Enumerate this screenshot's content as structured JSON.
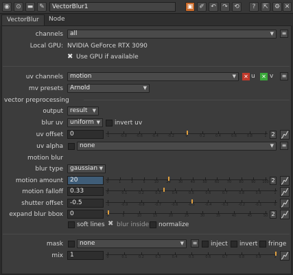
{
  "header": {
    "title": "VectorBlur1"
  },
  "tabs": [
    "VectorBlur",
    "Node"
  ],
  "channels": {
    "label": "channels",
    "value": "all"
  },
  "local_gpu": {
    "label": "Local GPU:",
    "value": "NVIDIA GeForce RTX 3090"
  },
  "use_gpu": {
    "label": "Use GPU if available",
    "checked": true
  },
  "uv_channels": {
    "label": "uv channels",
    "value": "motion",
    "u_label": "u",
    "v_label": "v"
  },
  "mv_presets": {
    "label": "mv presets",
    "value": "Arnold"
  },
  "vector_preprocessing": {
    "label": "vector preprocessing"
  },
  "output": {
    "label": "output",
    "value": "result"
  },
  "blur_uv": {
    "label": "blur uv",
    "value": "uniform",
    "invert_label": "invert uv"
  },
  "uv_offset": {
    "label": "uv offset",
    "value": "0",
    "ticks": [
      "-1",
      "-0.8",
      "-0.6",
      "-0.4",
      "-0.2",
      "0",
      "0.2",
      "0.4",
      "0.6",
      "0.8",
      "1"
    ],
    "num_btn": "2"
  },
  "uv_alpha": {
    "label": "uv alpha",
    "value": "none"
  },
  "motion_blur": {
    "label": "motion blur"
  },
  "blur_type": {
    "label": "blur type",
    "value": "gaussian"
  },
  "motion_amount": {
    "label": "motion amount",
    "value": "20",
    "ticks": [
      "0",
      "1",
      "3",
      "5",
      "10",
      "20",
      "30",
      "40",
      "50",
      "60",
      "70",
      "80",
      "90",
      "100"
    ],
    "num_btn": "2"
  },
  "motion_falloff": {
    "label": "motion falloff",
    "value": "0.33",
    "ticks": [
      "0",
      "0.1",
      "0.2",
      "0.3",
      "0.4",
      "0.5",
      "0.6",
      "0.7",
      "0.8",
      "0.9",
      "1"
    ]
  },
  "shutter_offset": {
    "label": "shutter offset",
    "value": "-0.5",
    "ticks": [
      "-1",
      "-0.9",
      "-0.8",
      "-0.7",
      "-0.6",
      "-0.5",
      "-0.4",
      "-0.3",
      "-0.2",
      "-0.1",
      "0"
    ]
  },
  "expand_blur_bbox": {
    "label": "expand blur bbox",
    "value": "0",
    "ticks": [
      "0",
      "5",
      "10",
      "15",
      "20",
      "25",
      "30",
      "35",
      "40",
      "45",
      "50"
    ],
    "num_btn": "2"
  },
  "options": {
    "soft_lines": "soft lines",
    "blur_inside": "blur inside",
    "normalize": "normalize"
  },
  "mask": {
    "label": "mask",
    "value": "none",
    "inject": "inject",
    "invert": "invert",
    "fringe": "fringe"
  },
  "mix": {
    "label": "mix",
    "value": "1",
    "ticks": [
      "0",
      "0.1",
      "0.2",
      "0.3",
      "0.4",
      "0.5",
      "0.6",
      "0.7",
      "0.8",
      "0.9",
      "1"
    ]
  }
}
